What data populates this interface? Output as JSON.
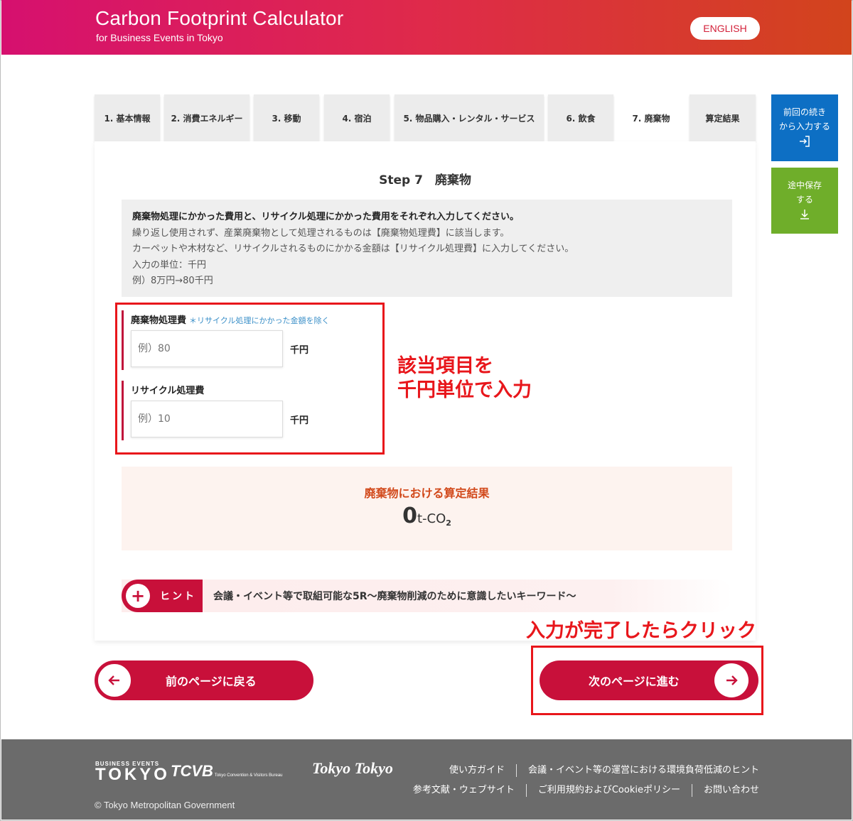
{
  "header": {
    "title": "Carbon Footprint Calculator",
    "subtitle": "for Business Events in Tokyo",
    "language_button": "ENGLISH"
  },
  "tabs": [
    {
      "label": "1. 基本情報",
      "active": false
    },
    {
      "label": "2. 消費エネルギー",
      "active": false
    },
    {
      "label": "3. 移動",
      "active": false
    },
    {
      "label": "4. 宿泊",
      "active": false
    },
    {
      "label": "5. 物品購入・レンタル・サービス",
      "active": false
    },
    {
      "label": "6. 飲食",
      "active": false
    },
    {
      "label": "7. 廃棄物",
      "active": true
    },
    {
      "label": "算定結果",
      "active": false
    }
  ],
  "side": {
    "resume_line1": "前回の続き",
    "resume_line2": "から入力する",
    "resume_icon": "login-icon",
    "save_line1": "途中保存",
    "save_line2": "する",
    "save_icon": "download-icon",
    "resume_color": "#0d6fc4",
    "save_color": "#6fae2a"
  },
  "main": {
    "step_title": "Step 7　廃棄物",
    "instructions": [
      "廃棄物処理にかかった費用と、リサイクル処理にかかった費用をそれぞれ入力してください。",
      "繰り返し使用されず、産業廃棄物として処理されるものは【廃棄物処理費】に該当します。",
      "カーペットや木材など、リサイクルされるものにかかる金額は【リサイクル処理費】に入力してください。",
      "入力の単位：千円",
      "例）8万円→80千円"
    ],
    "fields": {
      "waste": {
        "label": "廃棄物処理費",
        "note": "＊リサイクル処理にかかった金額を除く",
        "value": "",
        "placeholder": "例）80",
        "unit": "千円"
      },
      "recycle": {
        "label": "リサイクル処理費",
        "value": "",
        "placeholder": "例）10",
        "unit": "千円"
      }
    },
    "result": {
      "title": "廃棄物における算定結果",
      "value": "0",
      "unit": "t-CO",
      "unit_sub": "2"
    },
    "hint": {
      "badge": "ヒント",
      "text": "会議・イベント等で取組可能な5R〜廃棄物削減のために意識したいキーワード〜"
    }
  },
  "annotations": {
    "input_line1": "該当項目を",
    "input_line2": "千円単位で入力",
    "click": "入力が完了したらクリック",
    "color": "#e8161b"
  },
  "nav": {
    "prev_label": "前のページに戻る",
    "next_label": "次のページに進む",
    "accent_color": "#c8103a"
  },
  "footer": {
    "logo1_small": "BUSINESS EVENTS",
    "logo1_big": "TOKYO",
    "logo2": "TCVB",
    "logo2_sub": "Tokyo Convention & Visitors Bureau",
    "logo3": "Tokyo Tokyo",
    "links_row1": [
      "使い方ガイド",
      "会議・イベント等の運営における環境負荷低減のヒント"
    ],
    "links_row2": [
      "参考文献・ウェブサイト",
      "ご利用規約およびCookieポリシー",
      "お問い合わせ"
    ],
    "copyright": "© Tokyo Metropolitan Government"
  }
}
